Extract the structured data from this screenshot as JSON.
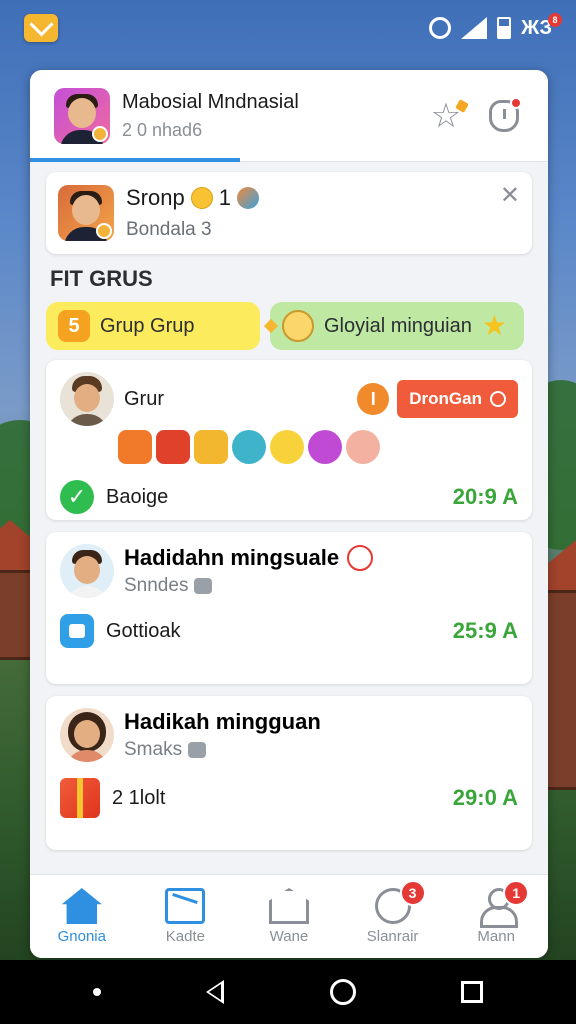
{
  "status_bar": {
    "right_text": "ЖЗ",
    "badge": "8"
  },
  "header": {
    "title": "Mabosial Mndnasial",
    "subtitle": "2 0 nhad6"
  },
  "group_card": {
    "title": "Sronp",
    "count": "1",
    "subtitle": "Bondala 3"
  },
  "section": {
    "title": "FIT GRUS"
  },
  "chips": [
    {
      "label": "Grup Grup",
      "icon": "5"
    },
    {
      "label": "Gloyial minguian"
    }
  ],
  "feed": [
    {
      "name": "Grur",
      "action_label": "DronGan",
      "side_icon": "I",
      "status_label": "Baoige",
      "points": "20:9 A"
    },
    {
      "name": "Hadidahn mingsuale",
      "sub": "Snndes",
      "status_label": "Gottioak",
      "points": "25:9 A"
    },
    {
      "name": "Hadikah mingguan",
      "sub": "Smaks",
      "status_label": "2 1lolt",
      "points": "29:0 A"
    }
  ],
  "bottom_nav": [
    {
      "label": "Gnonia",
      "active": true
    },
    {
      "label": "Kadte"
    },
    {
      "label": "Wane"
    },
    {
      "label": "Slanrair",
      "badge": "3"
    },
    {
      "label": "Mann",
      "badge": "1"
    }
  ],
  "colors": {
    "accent": "#2f8fe0",
    "points_green": "#3aa63a",
    "action_red": "#f05c3b"
  }
}
